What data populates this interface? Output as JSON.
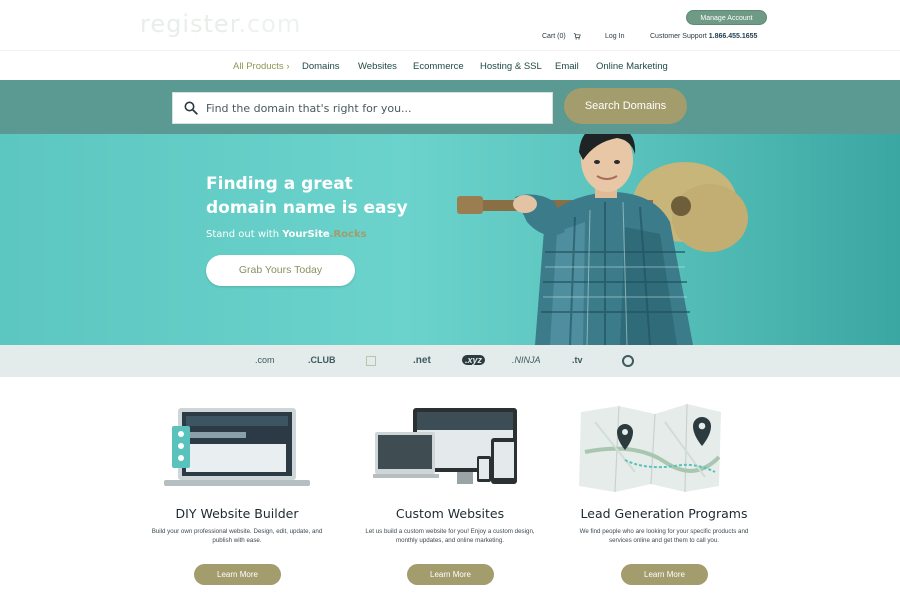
{
  "header": {
    "logo_left": "register",
    "logo_right": ".com",
    "manage_account_label": "Manage Account",
    "cart_label": "Cart (0)",
    "login_label": "Log In",
    "support_label": "Customer Support",
    "support_phone": "1.866.455.1655"
  },
  "nav": {
    "items": [
      {
        "label": "All Products ›"
      },
      {
        "label": "Domains"
      },
      {
        "label": "Websites"
      },
      {
        "label": "Ecommerce"
      },
      {
        "label": "Hosting & SSL"
      },
      {
        "label": "Email"
      },
      {
        "label": "Online Marketing"
      }
    ]
  },
  "search": {
    "placeholder": "Find the domain that's right for you...",
    "button_label": "Search Domains"
  },
  "hero": {
    "title_line1": "Finding a great",
    "title_line2": "domain name is easy",
    "subtitle_prefix": "Stand out with ",
    "subtitle_brand": "YourSite",
    "subtitle_brand2": ".Rocks",
    "cta_label": "Grab Yours Today"
  },
  "tlds": [
    ".com",
    ".CLUB",
    "",
    ".net",
    ".xyz",
    ".NINJA",
    ".tv",
    ""
  ],
  "services": [
    {
      "title": "DIY Website Builder",
      "description": "Build your own professional website. Design, edit, update, and publish with ease.",
      "button_label": "Learn More"
    },
    {
      "title": "Custom Websites",
      "description": "Let us build a custom website for you! Enjoy a custom design, monthly updates, and online marketing.",
      "button_label": "Learn More"
    },
    {
      "title": "Lead Generation Programs",
      "description": "We find people who are looking for your specific products and services online and get them to call you.",
      "button_label": "Learn More"
    }
  ],
  "colors": {
    "accent_olive": "#a39c6c",
    "teal_band": "#5b9a93",
    "hero_teal": "#6bd3cc",
    "manage_green": "#6f9a85"
  },
  "icons": [
    "search-icon",
    "cart-icon"
  ]
}
